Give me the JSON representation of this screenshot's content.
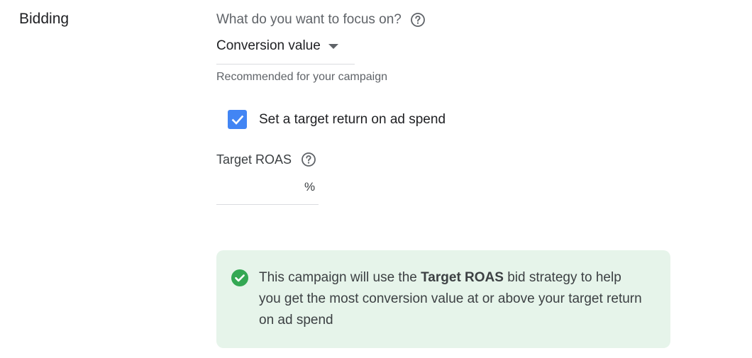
{
  "section": {
    "title": "Bidding"
  },
  "focus": {
    "question": "What do you want to focus on?",
    "help_icon": "help-circle-icon",
    "selected": "Conversion value",
    "recommendation": "Recommended for your campaign"
  },
  "target_return": {
    "checkbox_label": "Set a target return on ad spend",
    "checked": true,
    "checkbox_color": "#4285f4"
  },
  "target_roas": {
    "label": "Target ROAS",
    "help_icon": "help-circle-icon",
    "value": "",
    "suffix": "%"
  },
  "info": {
    "icon": "check-circle-icon",
    "icon_color": "#34a853",
    "background": "#e6f4ea",
    "text_before": "This campaign will use the ",
    "text_bold": "Target ROAS",
    "text_after": " bid strategy to help you get the most conversion value at or above your target return on ad spend"
  }
}
